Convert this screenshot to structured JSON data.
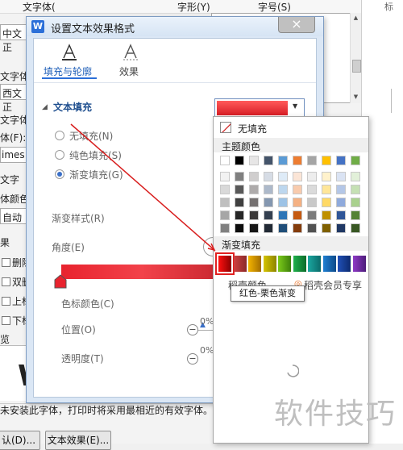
{
  "background_dialog": {
    "top_labels": [
      "文字体(",
      "字形(Y)",
      "字号(S)"
    ],
    "left_labels": [
      "中文正",
      "文字体",
      "西文正",
      "文字体",
      "体(F):",
      "imes",
      "文字",
      "体颜色",
      "自动",
      "果",
      "删除线",
      "双删除",
      "上标(",
      "下标(",
      "览",
      "W"
    ],
    "note": "未安装此字体，打印时将采用最相近的有效字体。",
    "buttons": {
      "default": "认(D)...",
      "text_effect": "文本效果(E)..."
    },
    "right_label": "标"
  },
  "dialog": {
    "title": "设置文本效果格式",
    "close_glyph": "×",
    "tabs": [
      {
        "label": "填充与轮廓",
        "icon": "text-fill-icon",
        "active": true
      },
      {
        "label": "效果",
        "icon": "text-effect-icon",
        "active": false
      }
    ],
    "section_title": "文本填充",
    "fill_options": [
      {
        "label": "无填充(N)",
        "selected": false
      },
      {
        "label": "纯色填充(S)",
        "selected": false
      },
      {
        "label": "渐变填充(G)",
        "selected": true
      }
    ],
    "gradient_style_label": "渐变样式(R)",
    "angle_label": "角度(E)",
    "stop_color_label": "色标颜色(C)",
    "position_label": "位置(O)",
    "position_value": "0%",
    "transparency_label": "透明度(T)",
    "transparency_value": "0%",
    "minus_glyph": "−",
    "dropdown_color": "#e03038"
  },
  "color_popup": {
    "no_fill_label": "无填充",
    "theme_colors_label": "主题颜色",
    "gradient_label": "渐变填充",
    "more_colors_label": "稻壳颜色",
    "member_label": "稻壳会员专享",
    "tooltip": "红色-栗色渐变",
    "theme_top": [
      "#ffffff",
      "#000000",
      "#e7e6e6",
      "#44546a",
      "#5b9bd5",
      "#ed7d31",
      "#a5a5a5",
      "#ffc000",
      "#4472c4",
      "#70ad47"
    ],
    "theme_cols": [
      [
        "#f2f2f2",
        "#d9d9d9",
        "#bfbfbf",
        "#a6a6a6",
        "#808080"
      ],
      [
        "#808080",
        "#595959",
        "#404040",
        "#262626",
        "#0d0d0d"
      ],
      [
        "#d0cece",
        "#aeabab",
        "#757171",
        "#3a3838",
        "#161616"
      ],
      [
        "#d6dce5",
        "#adb9ca",
        "#8497b0",
        "#333f50",
        "#222a35"
      ],
      [
        "#deebf7",
        "#bdd7ee",
        "#9dc3e6",
        "#2e75b6",
        "#1f4e79"
      ],
      [
        "#fbe5d6",
        "#f8cbad",
        "#f4b183",
        "#c55a11",
        "#843c0c"
      ],
      [
        "#ededed",
        "#dbdbdb",
        "#c9c9c9",
        "#7b7b7b",
        "#525252"
      ],
      [
        "#fff2cc",
        "#ffe699",
        "#ffd966",
        "#bf9000",
        "#7f6000"
      ],
      [
        "#dae3f3",
        "#b4c7e7",
        "#8faadc",
        "#2f5597",
        "#203864"
      ],
      [
        "#e2f0d9",
        "#c5e0b4",
        "#a9d18e",
        "#548235",
        "#385723"
      ]
    ],
    "gradients": [
      [
        "#ff1010",
        "#8b0000"
      ],
      [
        "#d04040",
        "#8a2a2a"
      ],
      [
        "#f3b400",
        "#a36d00"
      ],
      [
        "#d6c400",
        "#8c8400"
      ],
      [
        "#7ccb1a",
        "#3d7f0a"
      ],
      [
        "#1fb04c",
        "#0c6b2a"
      ],
      [
        "#1aa7a0",
        "#0b6b6a"
      ],
      [
        "#1f7fd1",
        "#0d4a8a"
      ],
      [
        "#2050b8",
        "#0d2a6e"
      ],
      [
        "#8e3ac6",
        "#4d1c7a"
      ]
    ],
    "highlight_color": "#e02020"
  },
  "watermark": "软件技巧"
}
